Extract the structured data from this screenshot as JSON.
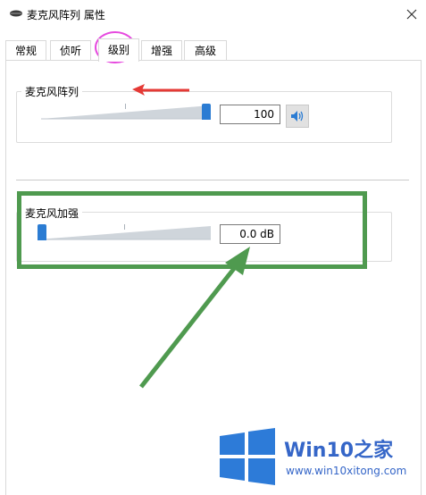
{
  "window": {
    "title": "麦克风阵列 属性",
    "close_glyph": "✕"
  },
  "tabs": [
    {
      "label": "常规",
      "active": false
    },
    {
      "label": "侦听",
      "active": false
    },
    {
      "label": "级别",
      "active": true
    },
    {
      "label": "增强",
      "active": false
    },
    {
      "label": "高级",
      "active": false
    }
  ],
  "microphone_array": {
    "label": "麦克风阵列",
    "level": 100,
    "value_text": "100",
    "speaker_icon": "speaker-icon"
  },
  "microphone_boost": {
    "label": "麦克风加强",
    "level": 0,
    "value_text": "0.0 dB"
  },
  "annotations": {
    "tab_circle_color": "#e64adf",
    "arrow_red_color": "#e53935",
    "highlight_color": "#4f9a4f",
    "arrow_green_color": "#4f9a4f"
  },
  "watermark": {
    "brand": "Win10",
    "brand_suffix": "之家",
    "url": "www.win10xitong.com",
    "logo_color": "#3566c8"
  }
}
